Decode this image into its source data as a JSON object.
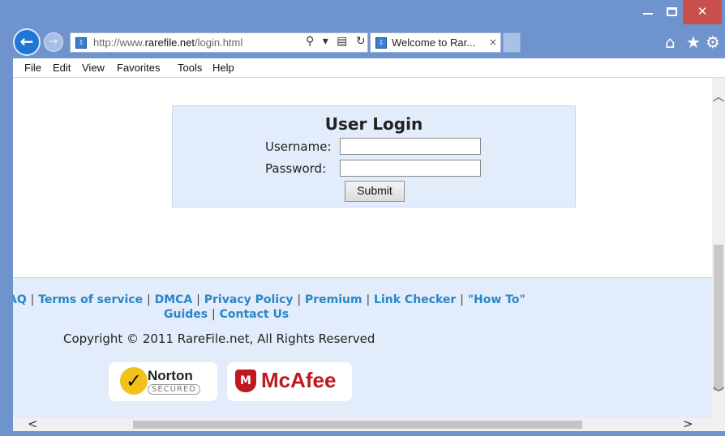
{
  "window": {
    "minimize_label": "minimize",
    "maximize_label": "maximize",
    "close_glyph": "✕"
  },
  "nav": {
    "back_glyph": "←",
    "forward_glyph": "→",
    "url_prefix": "http://www.",
    "url_domain": "rarefile.net",
    "url_path": "/login.html",
    "addr_tools": "⚲ ▾ ▤ ↻"
  },
  "tab": {
    "title": "Welcome to Rar...",
    "close_glyph": "×"
  },
  "toolbar_icons": {
    "home": "home-icon",
    "favorites": "star-icon",
    "tools": "gear-icon"
  },
  "menu": {
    "items": [
      "File",
      "Edit",
      "View",
      "Favorites",
      "Tools",
      "Help"
    ]
  },
  "login": {
    "title": "User Login",
    "username_label": "Username:",
    "password_label": "Password:",
    "username_value": "",
    "password_value": "",
    "submit_label": "Submit"
  },
  "footer": {
    "links": [
      "AQ",
      "Terms of service",
      "DMCA",
      "Privacy Policy",
      "Premium",
      "Link Checker",
      "\"How To\"",
      "Guides",
      "Contact Us"
    ],
    "copyright": "Copyright © 2011 RareFile.net, All Rights Reserved",
    "norton": {
      "name": "Norton",
      "sub": "SECURED"
    },
    "mcafee": {
      "name": "McAfee"
    }
  },
  "colors": {
    "chrome_blue": "#6f93cc",
    "back_button": "#1f76d7",
    "close_button": "#c7504a",
    "login_box_bg": "#e2ecfb",
    "footer_bg": "#e3ecfa",
    "link_color": "#2a86c8",
    "mcafee_red": "#c0181f",
    "norton_yellow": "#f2c21a"
  }
}
